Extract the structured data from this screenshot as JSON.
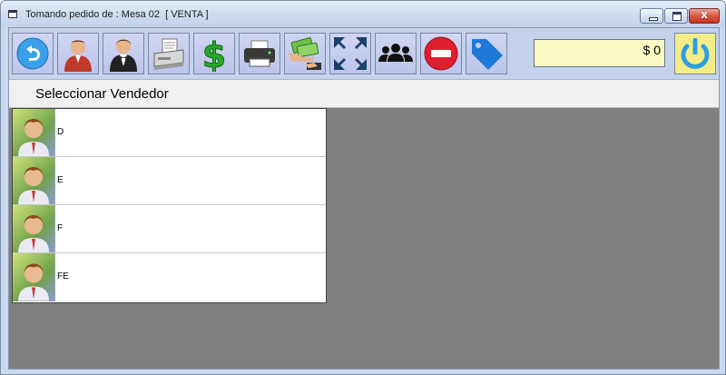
{
  "window": {
    "title": "Tomando pedido de : Mesa 02  [ VENTA ]",
    "close_glyph": "x"
  },
  "toolbar": {
    "buttons": [
      {
        "name": "back-icon",
        "color": "#3aa0e8"
      },
      {
        "name": "waiter-icon",
        "color": "#c0392b"
      },
      {
        "name": "butler-icon",
        "color": "#222222"
      },
      {
        "name": "receipt-printer-icon",
        "color": "#888888"
      },
      {
        "name": "dollar-icon",
        "color": "#2aa52a"
      },
      {
        "name": "printer-icon",
        "color": "#444444"
      },
      {
        "name": "money-hand-icon",
        "color": "#6bbf4a"
      },
      {
        "name": "fullscreen-icon",
        "color": "#1c3f6e"
      },
      {
        "name": "group-icon",
        "color": "#111111"
      },
      {
        "name": "cancel-icon",
        "color": "#e01f2e"
      },
      {
        "name": "tag-icon",
        "color": "#1f79d6"
      }
    ],
    "total_label": "$ 0",
    "total_bg": "#fafac4",
    "power_icon": "power-icon"
  },
  "header": {
    "title": "Seleccionar Vendedor"
  },
  "vendors": [
    {
      "name": "D"
    },
    {
      "name": "E"
    },
    {
      "name": "F"
    },
    {
      "name": "FE"
    }
  ]
}
